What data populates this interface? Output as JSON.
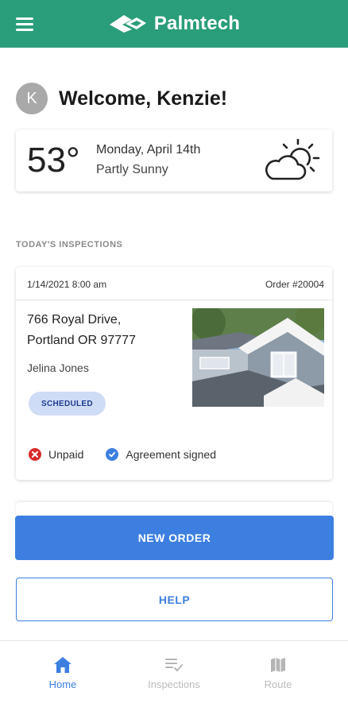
{
  "header": {
    "brand": "Palmtech",
    "menu_icon": "hamburger-menu-icon",
    "brand_color": "#2a9d7a"
  },
  "welcome": {
    "avatar_initial": "K",
    "text": "Welcome, Kenzie!"
  },
  "weather": {
    "temperature": "53°",
    "date": "Monday, April 14th",
    "condition": "Partly Sunny",
    "icon": "partly-sunny-icon"
  },
  "section": {
    "label": "TODAY'S INSPECTIONS"
  },
  "inspection": {
    "datetime": "1/14/2021 8:00 am",
    "order": "Order #20004",
    "address_line1": "766 Royal Drive,",
    "address_line2": "Portland OR  97777",
    "client": "Jelina Jones",
    "status": "SCHEDULED",
    "payment": "Unpaid",
    "agreement": "Agreement signed",
    "payment_color": "#d92b2b",
    "agreement_color": "#3d7fe0"
  },
  "actions": {
    "new_order": "NEW ORDER",
    "help": "HELP",
    "accent": "#3d7fe0"
  },
  "nav": {
    "items": [
      {
        "label": "Home",
        "icon": "home-icon",
        "active": true
      },
      {
        "label": "Inspections",
        "icon": "inspections-list-icon",
        "active": false
      },
      {
        "label": "Route",
        "icon": "map-icon",
        "active": false
      }
    ]
  }
}
